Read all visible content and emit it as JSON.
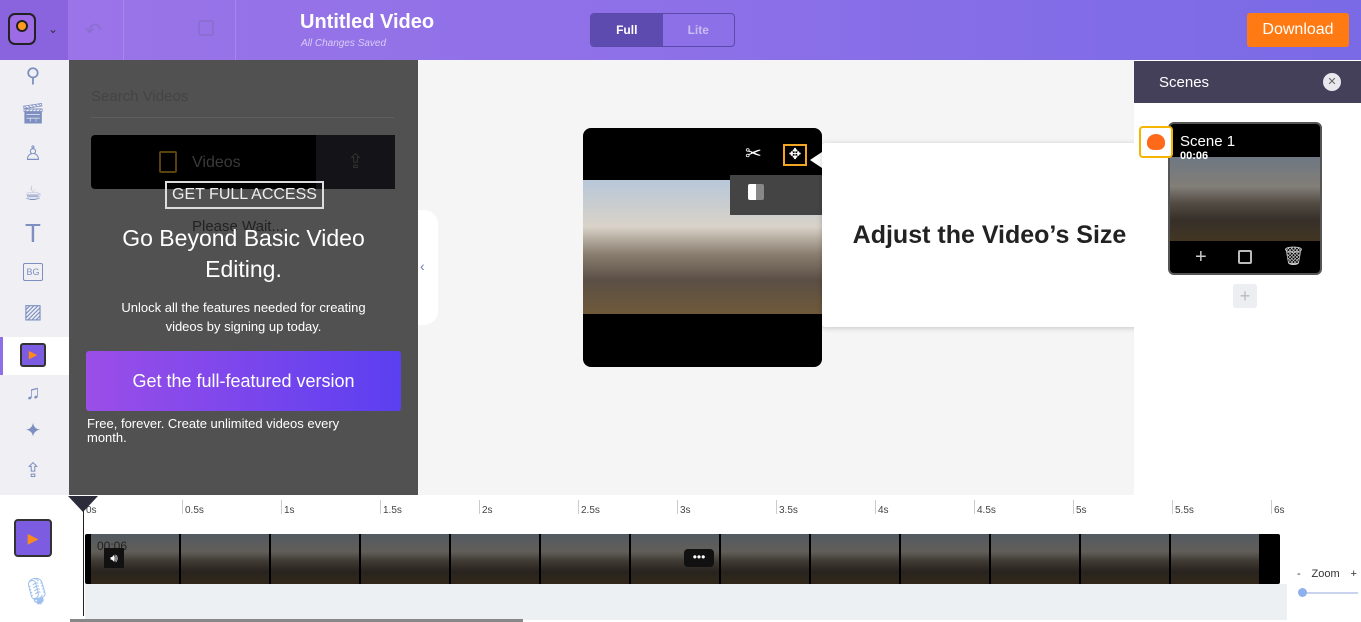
{
  "header": {
    "title": "Untitled Video",
    "saved_status": "All Changes Saved",
    "modes": [
      "Full",
      "Lite"
    ],
    "active_mode": "Full",
    "download_label": "Download"
  },
  "rail": {
    "icons": [
      "search-icon",
      "clapperboard-icon",
      "character-icon",
      "coffee-icon",
      "text-icon",
      "background-icon",
      "image-icon",
      "video-icon",
      "music-icon",
      "effects-icon",
      "upload-icon"
    ],
    "active": "video-icon"
  },
  "panel": {
    "search_placeholder": "Search Videos",
    "tab_label": "Videos",
    "loading": "Please Wait...",
    "badge": "GET FULL ACCESS",
    "headline": "Go Beyond Basic Video Editing.",
    "subtext": "Unlock all the features needed for creating videos by signing up today.",
    "cta_label": "Get the full-featured version",
    "footnote": "Free, forever. Create unlimited videos every month."
  },
  "tooltip": {
    "text": "Adjust the Video’s Size"
  },
  "scenes": {
    "title": "Scenes",
    "items": [
      {
        "name": "Scene 1",
        "duration": "00:06"
      }
    ]
  },
  "timeline": {
    "ticks": [
      "0s",
      "0.5s",
      "1s",
      "1.5s",
      "2s",
      "2.5s",
      "3s",
      "3.5s",
      "4s",
      "4.5s",
      "5s",
      "5.5s",
      "6s"
    ],
    "clip_duration": "00:06",
    "zoom_label": "Zoom",
    "zoom_minus": "-",
    "zoom_plus": "+"
  },
  "colors": {
    "accent": "#8d70e8",
    "download": "#ff7a12",
    "cta": "#7b4ff0"
  }
}
